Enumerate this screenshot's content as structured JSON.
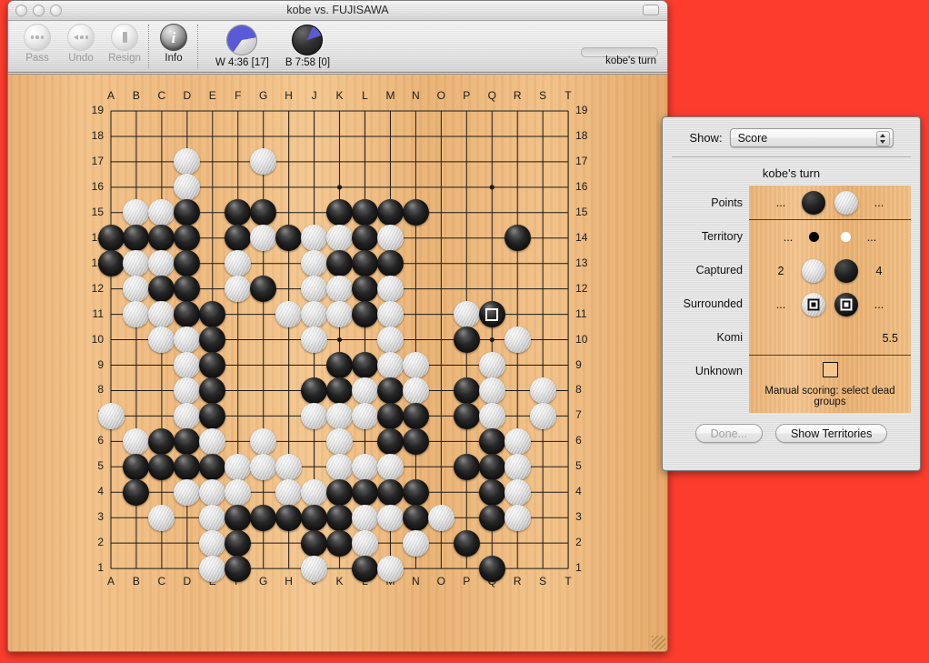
{
  "window": {
    "title": "kobe vs. FUJISAWA",
    "controls": [
      "close",
      "minimize",
      "zoom"
    ]
  },
  "toolbar": {
    "buttons": [
      {
        "label": "Pass",
        "icon": "pass-icon",
        "enabled": false
      },
      {
        "label": "Undo",
        "icon": "undo-icon",
        "enabled": false
      },
      {
        "label": "Resign",
        "icon": "resign-icon",
        "enabled": false
      },
      {
        "label": "Info",
        "icon": "info-icon",
        "enabled": true
      }
    ],
    "clocks": [
      {
        "icon": "white-clock-icon",
        "text": "W 4:36 [17]"
      },
      {
        "icon": "black-clock-icon",
        "text": "B 7:58 [0]"
      }
    ],
    "status": "kobe's turn"
  },
  "board": {
    "size": 19,
    "col_labels": [
      "A",
      "B",
      "C",
      "D",
      "E",
      "F",
      "G",
      "H",
      "J",
      "K",
      "L",
      "M",
      "N",
      "O",
      "P",
      "Q",
      "R",
      "S",
      "T"
    ],
    "row_labels": [
      "19",
      "18",
      "17",
      "16",
      "15",
      "14",
      "13",
      "12",
      "11",
      "10",
      "9",
      "8",
      "7",
      "6",
      "5",
      "4",
      "3",
      "2",
      "1"
    ],
    "star_points": [
      [
        3,
        3
      ],
      [
        3,
        9
      ],
      [
        3,
        15
      ],
      [
        9,
        3
      ],
      [
        9,
        9
      ],
      [
        9,
        15
      ],
      [
        15,
        3
      ],
      [
        15,
        9
      ],
      [
        15,
        15
      ]
    ],
    "last_move": {
      "col": 15,
      "row": 8,
      "color": "black"
    },
    "stones": [
      {
        "c": 3,
        "r": 2,
        "s": "w"
      },
      {
        "c": 6,
        "r": 2,
        "s": "w"
      },
      {
        "c": 3,
        "r": 3,
        "s": "w"
      },
      {
        "c": 1,
        "r": 4,
        "s": "w"
      },
      {
        "c": 2,
        "r": 4,
        "s": "w"
      },
      {
        "c": 3,
        "r": 4,
        "s": "b"
      },
      {
        "c": 5,
        "r": 4,
        "s": "b"
      },
      {
        "c": 6,
        "r": 4,
        "s": "b"
      },
      {
        "c": 9,
        "r": 4,
        "s": "b"
      },
      {
        "c": 10,
        "r": 4,
        "s": "b"
      },
      {
        "c": 11,
        "r": 4,
        "s": "b"
      },
      {
        "c": 12,
        "r": 4,
        "s": "b"
      },
      {
        "c": 0,
        "r": 5,
        "s": "b"
      },
      {
        "c": 1,
        "r": 5,
        "s": "b"
      },
      {
        "c": 2,
        "r": 5,
        "s": "b"
      },
      {
        "c": 3,
        "r": 5,
        "s": "b"
      },
      {
        "c": 5,
        "r": 5,
        "s": "b"
      },
      {
        "c": 6,
        "r": 5,
        "s": "w"
      },
      {
        "c": 7,
        "r": 5,
        "s": "b"
      },
      {
        "c": 8,
        "r": 5,
        "s": "w"
      },
      {
        "c": 9,
        "r": 5,
        "s": "w"
      },
      {
        "c": 10,
        "r": 5,
        "s": "b"
      },
      {
        "c": 11,
        "r": 5,
        "s": "w"
      },
      {
        "c": 16,
        "r": 5,
        "s": "b"
      },
      {
        "c": 0,
        "r": 6,
        "s": "b"
      },
      {
        "c": 1,
        "r": 6,
        "s": "w"
      },
      {
        "c": 2,
        "r": 6,
        "s": "w"
      },
      {
        "c": 3,
        "r": 6,
        "s": "b"
      },
      {
        "c": 5,
        "r": 6,
        "s": "w"
      },
      {
        "c": 8,
        "r": 6,
        "s": "w"
      },
      {
        "c": 9,
        "r": 6,
        "s": "b"
      },
      {
        "c": 10,
        "r": 6,
        "s": "b"
      },
      {
        "c": 11,
        "r": 6,
        "s": "b"
      },
      {
        "c": 1,
        "r": 7,
        "s": "w"
      },
      {
        "c": 2,
        "r": 7,
        "s": "b"
      },
      {
        "c": 3,
        "r": 7,
        "s": "b"
      },
      {
        "c": 5,
        "r": 7,
        "s": "w"
      },
      {
        "c": 6,
        "r": 7,
        "s": "b"
      },
      {
        "c": 8,
        "r": 7,
        "s": "w"
      },
      {
        "c": 9,
        "r": 7,
        "s": "w"
      },
      {
        "c": 10,
        "r": 7,
        "s": "b"
      },
      {
        "c": 11,
        "r": 7,
        "s": "w"
      },
      {
        "c": 1,
        "r": 8,
        "s": "w"
      },
      {
        "c": 2,
        "r": 8,
        "s": "w"
      },
      {
        "c": 3,
        "r": 8,
        "s": "b"
      },
      {
        "c": 4,
        "r": 8,
        "s": "b"
      },
      {
        "c": 7,
        "r": 8,
        "s": "w"
      },
      {
        "c": 8,
        "r": 8,
        "s": "w"
      },
      {
        "c": 9,
        "r": 8,
        "s": "w"
      },
      {
        "c": 10,
        "r": 8,
        "s": "b"
      },
      {
        "c": 11,
        "r": 8,
        "s": "w"
      },
      {
        "c": 14,
        "r": 8,
        "s": "w"
      },
      {
        "c": 15,
        "r": 8,
        "s": "b"
      },
      {
        "c": 2,
        "r": 9,
        "s": "w"
      },
      {
        "c": 3,
        "r": 9,
        "s": "w"
      },
      {
        "c": 4,
        "r": 9,
        "s": "b"
      },
      {
        "c": 8,
        "r": 9,
        "s": "w"
      },
      {
        "c": 11,
        "r": 9,
        "s": "w"
      },
      {
        "c": 14,
        "r": 9,
        "s": "b"
      },
      {
        "c": 16,
        "r": 9,
        "s": "w"
      },
      {
        "c": 3,
        "r": 10,
        "s": "w"
      },
      {
        "c": 4,
        "r": 10,
        "s": "b"
      },
      {
        "c": 9,
        "r": 10,
        "s": "b"
      },
      {
        "c": 10,
        "r": 10,
        "s": "b"
      },
      {
        "c": 11,
        "r": 10,
        "s": "w"
      },
      {
        "c": 12,
        "r": 10,
        "s": "w"
      },
      {
        "c": 15,
        "r": 10,
        "s": "w"
      },
      {
        "c": 3,
        "r": 11,
        "s": "w"
      },
      {
        "c": 4,
        "r": 11,
        "s": "b"
      },
      {
        "c": 8,
        "r": 11,
        "s": "b"
      },
      {
        "c": 9,
        "r": 11,
        "s": "b"
      },
      {
        "c": 10,
        "r": 11,
        "s": "w"
      },
      {
        "c": 11,
        "r": 11,
        "s": "b"
      },
      {
        "c": 12,
        "r": 11,
        "s": "w"
      },
      {
        "c": 14,
        "r": 11,
        "s": "b"
      },
      {
        "c": 15,
        "r": 11,
        "s": "w"
      },
      {
        "c": 17,
        "r": 11,
        "s": "w"
      },
      {
        "c": 0,
        "r": 12,
        "s": "w"
      },
      {
        "c": 3,
        "r": 12,
        "s": "w"
      },
      {
        "c": 4,
        "r": 12,
        "s": "b"
      },
      {
        "c": 8,
        "r": 12,
        "s": "w"
      },
      {
        "c": 9,
        "r": 12,
        "s": "w"
      },
      {
        "c": 10,
        "r": 12,
        "s": "w"
      },
      {
        "c": 11,
        "r": 12,
        "s": "b"
      },
      {
        "c": 12,
        "r": 12,
        "s": "b"
      },
      {
        "c": 14,
        "r": 12,
        "s": "b"
      },
      {
        "c": 15,
        "r": 12,
        "s": "w"
      },
      {
        "c": 17,
        "r": 12,
        "s": "w"
      },
      {
        "c": 1,
        "r": 13,
        "s": "w"
      },
      {
        "c": 2,
        "r": 13,
        "s": "b"
      },
      {
        "c": 3,
        "r": 13,
        "s": "b"
      },
      {
        "c": 4,
        "r": 13,
        "s": "w"
      },
      {
        "c": 6,
        "r": 13,
        "s": "w"
      },
      {
        "c": 9,
        "r": 13,
        "s": "w"
      },
      {
        "c": 11,
        "r": 13,
        "s": "b"
      },
      {
        "c": 12,
        "r": 13,
        "s": "b"
      },
      {
        "c": 15,
        "r": 13,
        "s": "b"
      },
      {
        "c": 16,
        "r": 13,
        "s": "w"
      },
      {
        "c": 1,
        "r": 14,
        "s": "b"
      },
      {
        "c": 2,
        "r": 14,
        "s": "b"
      },
      {
        "c": 3,
        "r": 14,
        "s": "b"
      },
      {
        "c": 4,
        "r": 14,
        "s": "b"
      },
      {
        "c": 5,
        "r": 14,
        "s": "w"
      },
      {
        "c": 6,
        "r": 14,
        "s": "w"
      },
      {
        "c": 7,
        "r": 14,
        "s": "w"
      },
      {
        "c": 9,
        "r": 14,
        "s": "w"
      },
      {
        "c": 10,
        "r": 14,
        "s": "w"
      },
      {
        "c": 11,
        "r": 14,
        "s": "w"
      },
      {
        "c": 14,
        "r": 14,
        "s": "b"
      },
      {
        "c": 15,
        "r": 14,
        "s": "b"
      },
      {
        "c": 16,
        "r": 14,
        "s": "w"
      },
      {
        "c": 1,
        "r": 15,
        "s": "b"
      },
      {
        "c": 3,
        "r": 15,
        "s": "w"
      },
      {
        "c": 4,
        "r": 15,
        "s": "w"
      },
      {
        "c": 5,
        "r": 15,
        "s": "w"
      },
      {
        "c": 7,
        "r": 15,
        "s": "w"
      },
      {
        "c": 8,
        "r": 15,
        "s": "w"
      },
      {
        "c": 9,
        "r": 15,
        "s": "b"
      },
      {
        "c": 10,
        "r": 15,
        "s": "b"
      },
      {
        "c": 11,
        "r": 15,
        "s": "b"
      },
      {
        "c": 12,
        "r": 15,
        "s": "b"
      },
      {
        "c": 15,
        "r": 15,
        "s": "b"
      },
      {
        "c": 16,
        "r": 15,
        "s": "w"
      },
      {
        "c": 2,
        "r": 16,
        "s": "w"
      },
      {
        "c": 4,
        "r": 16,
        "s": "w"
      },
      {
        "c": 5,
        "r": 16,
        "s": "b"
      },
      {
        "c": 6,
        "r": 16,
        "s": "b"
      },
      {
        "c": 7,
        "r": 16,
        "s": "b"
      },
      {
        "c": 8,
        "r": 16,
        "s": "b"
      },
      {
        "c": 9,
        "r": 16,
        "s": "b"
      },
      {
        "c": 10,
        "r": 16,
        "s": "w"
      },
      {
        "c": 11,
        "r": 16,
        "s": "w"
      },
      {
        "c": 12,
        "r": 16,
        "s": "b"
      },
      {
        "c": 13,
        "r": 16,
        "s": "w"
      },
      {
        "c": 15,
        "r": 16,
        "s": "b"
      },
      {
        "c": 16,
        "r": 16,
        "s": "w"
      },
      {
        "c": 4,
        "r": 17,
        "s": "w"
      },
      {
        "c": 5,
        "r": 17,
        "s": "b"
      },
      {
        "c": 8,
        "r": 17,
        "s": "b"
      },
      {
        "c": 9,
        "r": 17,
        "s": "b"
      },
      {
        "c": 10,
        "r": 17,
        "s": "w"
      },
      {
        "c": 12,
        "r": 17,
        "s": "w"
      },
      {
        "c": 14,
        "r": 17,
        "s": "b"
      },
      {
        "c": 4,
        "r": 18,
        "s": "w"
      },
      {
        "c": 5,
        "r": 18,
        "s": "b"
      },
      {
        "c": 8,
        "r": 18,
        "s": "w"
      },
      {
        "c": 10,
        "r": 18,
        "s": "b"
      },
      {
        "c": 11,
        "r": 18,
        "s": "w"
      },
      {
        "c": 15,
        "r": 18,
        "s": "b"
      }
    ]
  },
  "score_panel": {
    "show_label": "Show:",
    "show_value": "Score",
    "turn": "kobe's turn",
    "rows": [
      {
        "label": "Points",
        "left_value": "...",
        "left_icon": "black-stone-icon",
        "right_icon": "white-stone-icon",
        "right_value": "..."
      },
      {
        "label": "Territory",
        "left_value": "...",
        "left_icon": "black-territory-dot-icon",
        "right_icon": "white-territory-dot-icon",
        "right_value": "..."
      },
      {
        "label": "Captured",
        "left_value": "2",
        "left_icon": "white-stone-icon",
        "right_icon": "black-stone-icon",
        "right_value": "4"
      },
      {
        "label": "Surrounded",
        "left_value": "...",
        "left_icon": "white-surrounded-icon",
        "right_icon": "black-surrounded-icon",
        "right_value": "..."
      },
      {
        "label": "Komi",
        "left_value": "",
        "left_icon": "",
        "right_icon": "",
        "right_value": "5.5"
      },
      {
        "label": "Unknown",
        "left_value": "",
        "left_icon": "unknown-box-icon",
        "right_icon": "",
        "right_value": ""
      }
    ],
    "manual_note": "Manual scoring: select dead groups",
    "done_button": "Done...",
    "territories_button": "Show Territories"
  },
  "colors": {
    "desktop_background": "#fc3d2e",
    "board_wood": "#eeb87d",
    "accent_blue": "#5a5ad6"
  }
}
